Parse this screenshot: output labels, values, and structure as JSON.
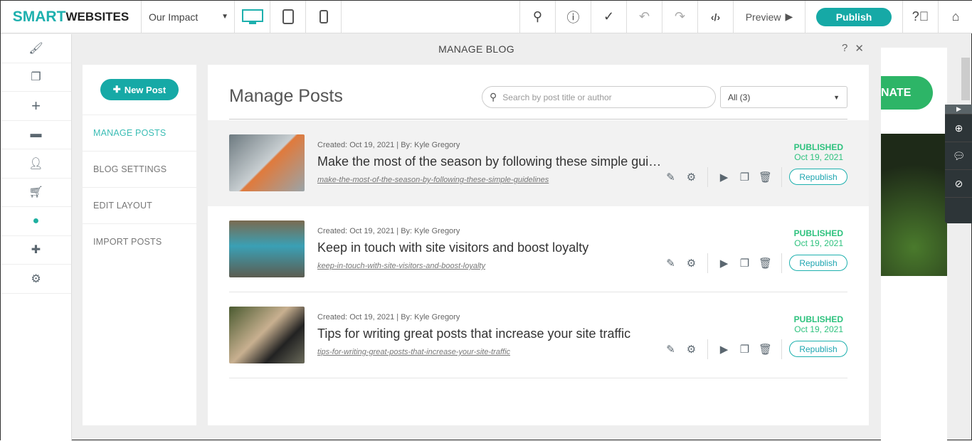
{
  "topbar": {
    "logo_a": "SMART",
    "logo_b": "WEBSITES",
    "page": "Our Impact",
    "preview": "Preview",
    "publish": "Publish"
  },
  "modal": {
    "title": "MANAGE BLOG",
    "help": "?",
    "close": "✕"
  },
  "left": {
    "new_post": "New Post",
    "nav": [
      "MANAGE POSTS",
      "BLOG SETTINGS",
      "EDIT LAYOUT",
      "IMPORT POSTS"
    ]
  },
  "main": {
    "heading": "Manage Posts",
    "search_placeholder": "Search by post title or author",
    "filter": "All (3)",
    "posts": [
      {
        "meta": "Created: Oct 19, 2021 | By: Kyle Gregory",
        "title": "Make the most of the season by following these simple guidelines",
        "slug": "make-the-most-of-the-season-by-following-these-simple-guidelines",
        "status": "PUBLISHED",
        "date": "Oct 19, 2021",
        "action": "Republish"
      },
      {
        "meta": "Created: Oct 19, 2021 | By: Kyle Gregory",
        "title": "Keep in touch with site visitors and boost loyalty",
        "slug": "keep-in-touch-with-site-visitors-and-boost-loyalty",
        "status": "PUBLISHED",
        "date": "Oct 19, 2021",
        "action": "Republish"
      },
      {
        "meta": "Created: Oct 19, 2021 | By: Kyle Gregory",
        "title": "Tips for writing great posts that increase your site traffic",
        "slug": "tips-for-writing-great-posts-that-increase-your-site-traffic",
        "status": "PUBLISHED",
        "date": "Oct 19, 2021",
        "action": "Republish"
      }
    ]
  },
  "site": {
    "button": "NATE"
  },
  "colors": {
    "accent": "#16a9a6",
    "published": "#2ec27e"
  }
}
